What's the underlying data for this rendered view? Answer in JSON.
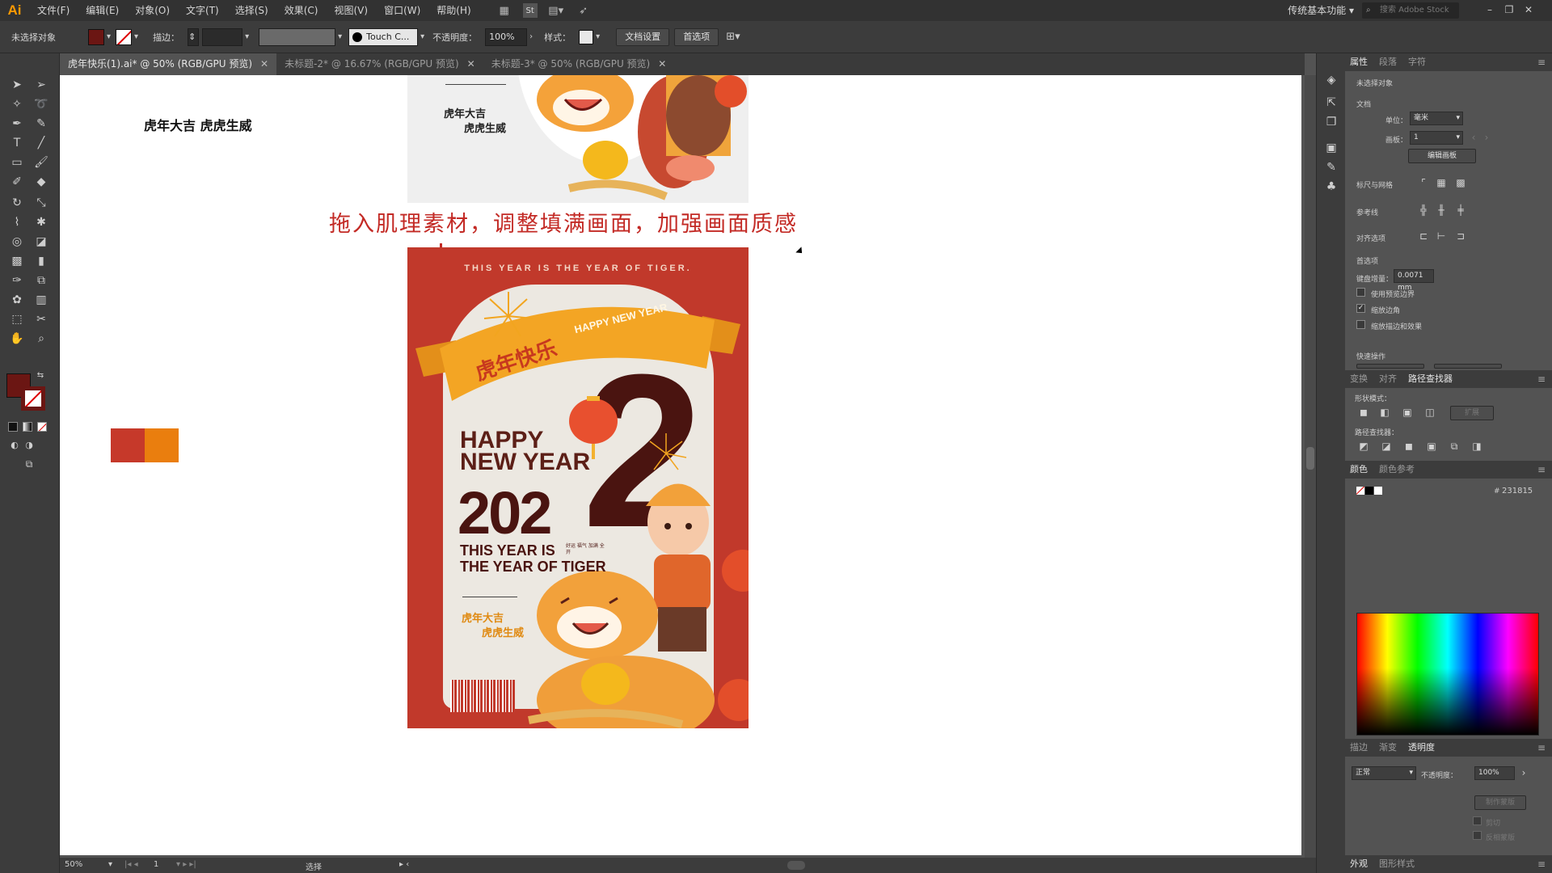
{
  "app": {
    "logo": "Ai"
  },
  "menus": [
    "文件(F)",
    "编辑(E)",
    "对象(O)",
    "文字(T)",
    "选择(S)",
    "效果(C)",
    "视图(V)",
    "窗口(W)",
    "帮助(H)"
  ],
  "menubar_icons": [
    "bridge-icon",
    "stock-icon",
    "arrange-icon",
    "gpu-icon"
  ],
  "workspace": "传统基本功能",
  "stock_search_placeholder": "搜索 Adobe Stock",
  "control_bar": {
    "selection": "未选择对象",
    "fill_color": "#6b1613",
    "stroke_label": "描边：",
    "brush": "Touch C...",
    "opacity_label": "不透明度：",
    "opacity": "100%",
    "style_label": "样式：",
    "doc_settings": "文档设置",
    "preferences": "首选项"
  },
  "tabs": [
    {
      "label": "虎年快乐(1).ai* @ 50% (RGB/GPU 预览)",
      "active": true
    },
    {
      "label": "未标题-2* @ 16.67% (RGB/GPU 预览)",
      "active": false
    },
    {
      "label": "未标题-3* @ 50% (RGB/GPU 预览)",
      "active": false
    }
  ],
  "canvas": {
    "note_black": "虎年大吉  虎虎生威",
    "note_red": "拖入肌理素材，调整填满画面，加强画面质感",
    "swatch_colors": [
      "#c6392a",
      "#ea7e0e"
    ]
  },
  "poster_top": {
    "line1": "虎年大吉",
    "line2": "虎虎生威"
  },
  "poster": {
    "top_text": "THIS YEAR IS THE YEAR OF TIGER.",
    "banner_cn": "虎年快乐",
    "banner_en": "HAPPY NEW YEAR",
    "happy": "HAPPY",
    "new_year": "NEW YEAR",
    "year": "202",
    "big_digit": "2",
    "this_year_1": "THIS YEAR IS",
    "this_year_2": "THE YEAR OF TIGER",
    "small_tag": "好运 福气 加满 全开",
    "cn1": "虎年大吉",
    "cn2": "虎虎生威"
  },
  "panel": {
    "tabs": [
      "属性",
      "段落",
      "字符"
    ],
    "no_selection": "未选择对象",
    "doc_section": "文档",
    "unit_label": "单位：",
    "unit": "毫米",
    "artboard_label": "画板：",
    "artboard": "1",
    "edit_artboard": "编辑画板",
    "rulers_grid": "标尺与网格",
    "guides": "参考线",
    "snap": "对齐选项",
    "prefs": "首选项",
    "key_increment_label": "键盘增量：",
    "key_increment": "0.0071 mm",
    "chk_preview": "使用预览边界",
    "chk_scale_corners": "缩放边角",
    "chk_scale_stroke": "缩放描边和效果",
    "quick_actions": "快速操作",
    "tabs2": [
      "变换",
      "对齐",
      "路径查找器"
    ],
    "shape_modes": "形状模式：",
    "expand": "扩展",
    "pathfinders": "路径查找器：",
    "color_tabs": [
      "颜色",
      "颜色参考"
    ],
    "hex_label": "#",
    "hex": "231815",
    "tabs3": [
      "描边",
      "渐变",
      "透明度"
    ],
    "blend_mode": "正常",
    "opacity_label": "不透明度：",
    "opacity": "100%",
    "make_mask": "制作蒙版",
    "clip": "剪切",
    "invert": "反相蒙版",
    "tabs4": [
      "外观",
      "图形样式"
    ]
  },
  "status": {
    "zoom": "50%",
    "page": "1",
    "tool": "选择"
  }
}
